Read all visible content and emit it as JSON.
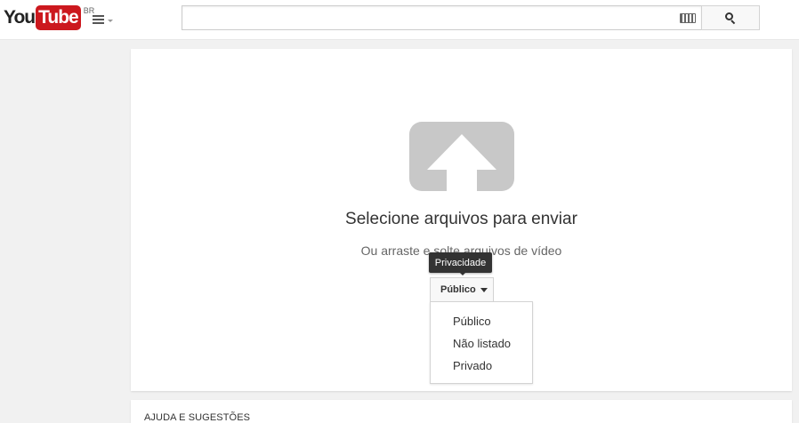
{
  "header": {
    "logo_you": "You",
    "logo_tube": "Tube",
    "country": "BR",
    "guide_icon": "hamburger-menu-icon",
    "search": {
      "placeholder": "",
      "value": "",
      "keyboard_icon": "keyboard-icon",
      "button_icon": "search-icon"
    }
  },
  "upload": {
    "icon": "upload-arrow-icon",
    "title": "Selecione arquivos para enviar",
    "subtitle": "Ou arraste e solte arquivos de vídeo",
    "tooltip": "Privacidade",
    "privacy_selected": "Público",
    "privacy_options": [
      "Público",
      "Não listado",
      "Privado"
    ]
  },
  "help": {
    "title": "AJUDA E SUGESTÕES"
  },
  "colors": {
    "brand_red": "#cc181e",
    "upload_icon_gray": "#c8c8c8",
    "background": "#f1f1f1"
  }
}
